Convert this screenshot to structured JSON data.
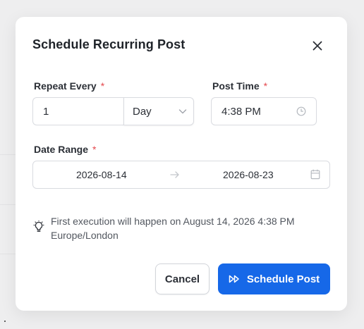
{
  "dialog": {
    "title": "Schedule Recurring Post"
  },
  "repeat": {
    "label": "Repeat Every",
    "required_mark": "*",
    "count": "1",
    "unit": "Day"
  },
  "post_time": {
    "label": "Post Time",
    "required_mark": "*",
    "value": "4:38 PM"
  },
  "date_range": {
    "label": "Date Range",
    "required_mark": "*",
    "start": "2026-08-14",
    "end": "2026-08-23"
  },
  "info": {
    "text": "First execution will happen on August 14, 2026 4:38 PM Europe/London"
  },
  "actions": {
    "cancel_label": "Cancel",
    "submit_label": "Schedule Post"
  },
  "colors": {
    "primary": "#1668e8",
    "required": "#e5484d"
  },
  "icons": {
    "close": "close-icon",
    "chevron": "chevron-down-icon",
    "clock": "clock-icon",
    "arrow": "arrow-right-icon",
    "calendar": "calendar-icon",
    "bulb": "lightbulb-icon",
    "submit": "fast-forward-icon"
  }
}
